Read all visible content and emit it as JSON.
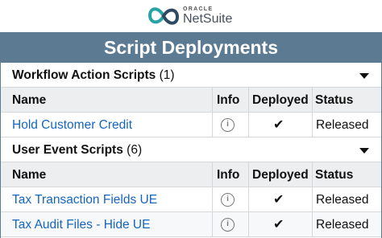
{
  "brand": {
    "oracle": "ORACLE",
    "name": "NetSuite"
  },
  "page_title": "Script Deployments",
  "columns": {
    "name": "Name",
    "info": "Info",
    "deployed": "Deployed",
    "status": "Status"
  },
  "sections": [
    {
      "title": "Workflow Action Scripts",
      "count": "(1)",
      "rows": [
        {
          "name": "Hold Customer Credit",
          "deployed": "✔",
          "status": "Released"
        }
      ]
    },
    {
      "title": "User Event Scripts",
      "count": "(6)",
      "rows": [
        {
          "name": "Tax Transaction Fields UE",
          "deployed": "✔",
          "status": "Released"
        },
        {
          "name": "Tax Audit Files - Hide UE",
          "deployed": "✔",
          "status": "Released"
        }
      ]
    }
  ],
  "icons": {
    "info": "i",
    "collapse": "chevron-down-icon"
  },
  "colors": {
    "title_bar": "#5c7b93",
    "link": "#1565c0",
    "header_bg": "#eceeef",
    "logo_teal": "#2aa3a5",
    "logo_navy": "#2e4a62"
  }
}
